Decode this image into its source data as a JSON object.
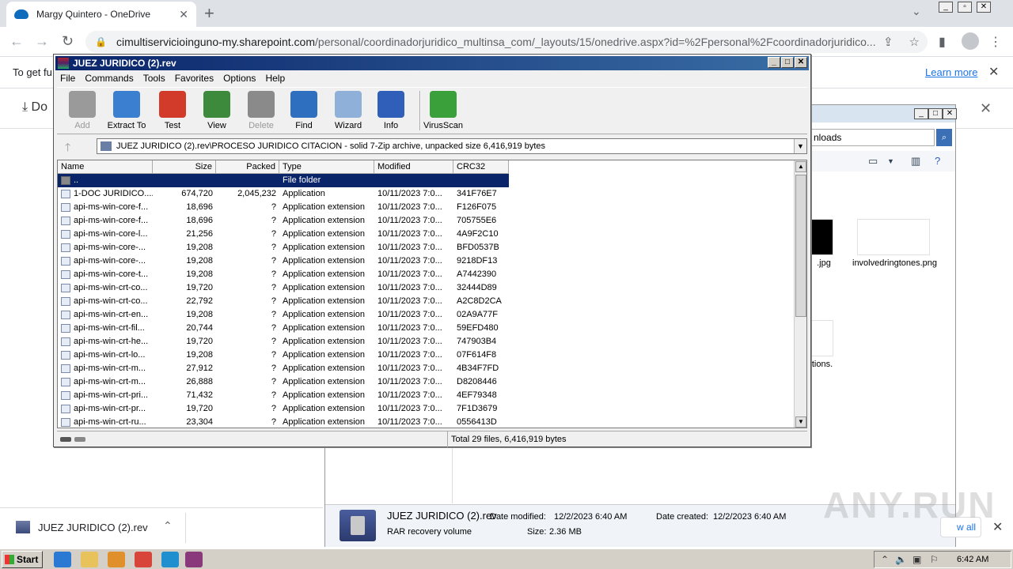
{
  "browser": {
    "tab_title": "Margy Quintero - OneDrive",
    "tab_close": "✕",
    "new_tab": "+",
    "url_host": "cimultiservicioinguno-my.sharepoint.com",
    "url_path": "/personal/coordinadorjuridico_multinsa_com/_layouts/15/onedrive.aspx?id=%2Fpersonal%2Fcoordinadorjuridico...",
    "infobar_text": "To get fu",
    "infobar_link": "Learn more",
    "od_download_label": "Do"
  },
  "winrar": {
    "title": "JUEZ JURIDICO (2).rev",
    "menu": [
      "File",
      "Commands",
      "Tools",
      "Favorites",
      "Options",
      "Help"
    ],
    "tools": [
      {
        "label": "Add",
        "disabled": true,
        "color": "#9a9a9a"
      },
      {
        "label": "Extract To",
        "disabled": false,
        "color": "#3a7fd0"
      },
      {
        "label": "Test",
        "disabled": false,
        "color": "#d23a2a"
      },
      {
        "label": "View",
        "disabled": false,
        "color": "#3d8a3d"
      },
      {
        "label": "Delete",
        "disabled": true,
        "color": "#8a8a8a"
      },
      {
        "label": "Find",
        "disabled": false,
        "color": "#2f6fc0"
      },
      {
        "label": "Wizard",
        "disabled": false,
        "color": "#8fb0d8"
      },
      {
        "label": "Info",
        "disabled": false,
        "color": "#2f5fb8"
      },
      {
        "label": "VirusScan",
        "disabled": false,
        "color": "#3aa03a"
      }
    ],
    "path": "JUEZ JURIDICO (2).rev\\PROCESO JURIDICO CITACION - solid 7-Zip archive, unpacked size 6,416,919 bytes",
    "columns": [
      "Name",
      "Size",
      "Packed",
      "Type",
      "Modified",
      "CRC32"
    ],
    "rows": [
      {
        "name": "..",
        "size": "",
        "packed": "",
        "type": "File folder",
        "modified": "",
        "crc": ""
      },
      {
        "name": "1-DOC JURIDICO....",
        "size": "674,720",
        "packed": "2,045,232",
        "type": "Application",
        "modified": "10/11/2023 7:0...",
        "crc": "341F76E7"
      },
      {
        "name": "api-ms-win-core-f...",
        "size": "18,696",
        "packed": "?",
        "type": "Application extension",
        "modified": "10/11/2023 7:0...",
        "crc": "F126F075"
      },
      {
        "name": "api-ms-win-core-f...",
        "size": "18,696",
        "packed": "?",
        "type": "Application extension",
        "modified": "10/11/2023 7:0...",
        "crc": "705755E6"
      },
      {
        "name": "api-ms-win-core-l...",
        "size": "21,256",
        "packed": "?",
        "type": "Application extension",
        "modified": "10/11/2023 7:0...",
        "crc": "4A9F2C10"
      },
      {
        "name": "api-ms-win-core-...",
        "size": "19,208",
        "packed": "?",
        "type": "Application extension",
        "modified": "10/11/2023 7:0...",
        "crc": "BFD0537B"
      },
      {
        "name": "api-ms-win-core-...",
        "size": "19,208",
        "packed": "?",
        "type": "Application extension",
        "modified": "10/11/2023 7:0...",
        "crc": "9218DF13"
      },
      {
        "name": "api-ms-win-core-t...",
        "size": "19,208",
        "packed": "?",
        "type": "Application extension",
        "modified": "10/11/2023 7:0...",
        "crc": "A7442390"
      },
      {
        "name": "api-ms-win-crt-co...",
        "size": "19,720",
        "packed": "?",
        "type": "Application extension",
        "modified": "10/11/2023 7:0...",
        "crc": "32444D89"
      },
      {
        "name": "api-ms-win-crt-co...",
        "size": "22,792",
        "packed": "?",
        "type": "Application extension",
        "modified": "10/11/2023 7:0...",
        "crc": "A2C8D2CA"
      },
      {
        "name": "api-ms-win-crt-en...",
        "size": "19,208",
        "packed": "?",
        "type": "Application extension",
        "modified": "10/11/2023 7:0...",
        "crc": "02A9A77F"
      },
      {
        "name": "api-ms-win-crt-fil...",
        "size": "20,744",
        "packed": "?",
        "type": "Application extension",
        "modified": "10/11/2023 7:0...",
        "crc": "59EFD480"
      },
      {
        "name": "api-ms-win-crt-he...",
        "size": "19,720",
        "packed": "?",
        "type": "Application extension",
        "modified": "10/11/2023 7:0...",
        "crc": "747903B4"
      },
      {
        "name": "api-ms-win-crt-lo...",
        "size": "19,208",
        "packed": "?",
        "type": "Application extension",
        "modified": "10/11/2023 7:0...",
        "crc": "07F614F8"
      },
      {
        "name": "api-ms-win-crt-m...",
        "size": "27,912",
        "packed": "?",
        "type": "Application extension",
        "modified": "10/11/2023 7:0...",
        "crc": "4B34F7FD"
      },
      {
        "name": "api-ms-win-crt-m...",
        "size": "26,888",
        "packed": "?",
        "type": "Application extension",
        "modified": "10/11/2023 7:0...",
        "crc": "D8208446"
      },
      {
        "name": "api-ms-win-crt-pri...",
        "size": "71,432",
        "packed": "?",
        "type": "Application extension",
        "modified": "10/11/2023 7:0...",
        "crc": "4EF79348"
      },
      {
        "name": "api-ms-win-crt-pr...",
        "size": "19,720",
        "packed": "?",
        "type": "Application extension",
        "modified": "10/11/2023 7:0...",
        "crc": "7F1D3679"
      },
      {
        "name": "api-ms-win-crt-ru...",
        "size": "23,304",
        "packed": "?",
        "type": "Application extension",
        "modified": "10/11/2023 7:0...",
        "crc": "0556413D"
      }
    ],
    "status": "Total 29 files, 6,416,919 bytes"
  },
  "explorer": {
    "address": "nloads",
    "thumb1_label": ".jpg",
    "thumb2_label": "involvedringtones.png",
    "thumb3_label": "tions.",
    "details": {
      "name": "JUEZ JURIDICO (2).rev",
      "type": "RAR recovery volume",
      "modified_label": "Date modified:",
      "modified": "12/2/2023 6:40 AM",
      "created_label": "Date created:",
      "created": "12/2/2023 6:40 AM",
      "size_label": "Size:",
      "size": "2.36 MB"
    }
  },
  "downloads": {
    "item": "JUEZ JURIDICO (2).rev",
    "show_all": "w all"
  },
  "watermark": "ANY.RUN",
  "taskbar": {
    "start": "Start",
    "time": "6:42 AM",
    "apps": [
      {
        "icon": "ie-icon",
        "color": "#2a7ad4"
      },
      {
        "icon": "folder-icon",
        "color": "#e8c25a"
      },
      {
        "icon": "media-icon",
        "color": "#e0902a"
      },
      {
        "icon": "chrome-icon",
        "color": "#d8443a"
      },
      {
        "icon": "edge-icon",
        "color": "#1f8fd0"
      },
      {
        "icon": "winrar-icon",
        "color": "#8a3a7a"
      }
    ]
  }
}
